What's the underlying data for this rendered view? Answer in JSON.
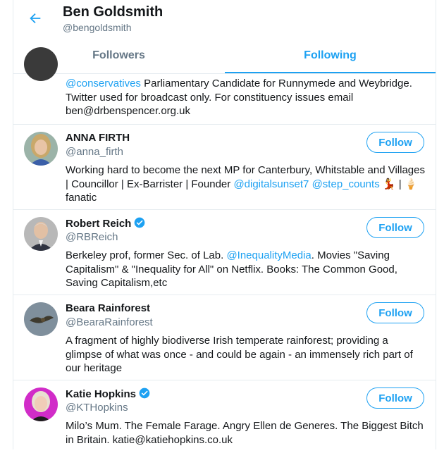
{
  "header": {
    "title": "Ben Goldsmith",
    "handle": "@bengoldsmith"
  },
  "tabs": [
    {
      "label": "Followers",
      "active": false
    },
    {
      "label": "Following",
      "active": true
    }
  ],
  "colors": {
    "accent": "#1da1f2",
    "secondary_text": "#657786",
    "border": "#e6ecf0"
  },
  "users": [
    {
      "partial": true,
      "bio": [
        {
          "text": "@conservatives",
          "mention": true
        },
        {
          "text": " Parliamentary Candidate for Runnymede and Weybridge. Twitter used for broadcast only. For constituency issues email ben@drbenspencer.org.uk",
          "mention": false
        }
      ]
    },
    {
      "name": "ANNA FIRTH",
      "username": "@anna_firth",
      "verified": false,
      "button": "Follow",
      "bio": [
        {
          "text": "Working hard to become the next MP for Canterbury, Whitstable and Villages | Councillor | Ex-Barrister | Founder ",
          "mention": false
        },
        {
          "text": "@digitalsunset7",
          "mention": true
        },
        {
          "text": " ",
          "mention": false
        },
        {
          "text": "@step_counts",
          "mention": true
        },
        {
          "text": " 💃 | 🍦 fanatic",
          "mention": false
        }
      ]
    },
    {
      "name": "Robert Reich",
      "username": "@RBReich",
      "verified": true,
      "button": "Follow",
      "bio": [
        {
          "text": "Berkeley prof, former Sec. of Lab. ",
          "mention": false
        },
        {
          "text": "@InequalityMedia",
          "mention": true
        },
        {
          "text": ". Movies \"Saving Capitalism\" & \"Inequality for All\" on Netflix. Books: The Common Good, Saving Capitalism,etc",
          "mention": false
        }
      ]
    },
    {
      "name": "Beara Rainforest",
      "username": "@BearaRainforest",
      "verified": false,
      "button": "Follow",
      "bio": [
        {
          "text": "A fragment of highly biodiverse Irish temperate rainforest; providing a glimpse of what was once - and could be again - an immensely rich part of our heritage",
          "mention": false
        }
      ]
    },
    {
      "name": "Katie Hopkins",
      "username": "@KTHopkins",
      "verified": true,
      "button": "Follow",
      "bio": [
        {
          "text": "Milo’s Mum. The Female Farage. Angry Ellen de Generes. The Biggest Bitch in Britain. katie@katiehopkins.co.uk",
          "mention": false
        }
      ]
    }
  ]
}
